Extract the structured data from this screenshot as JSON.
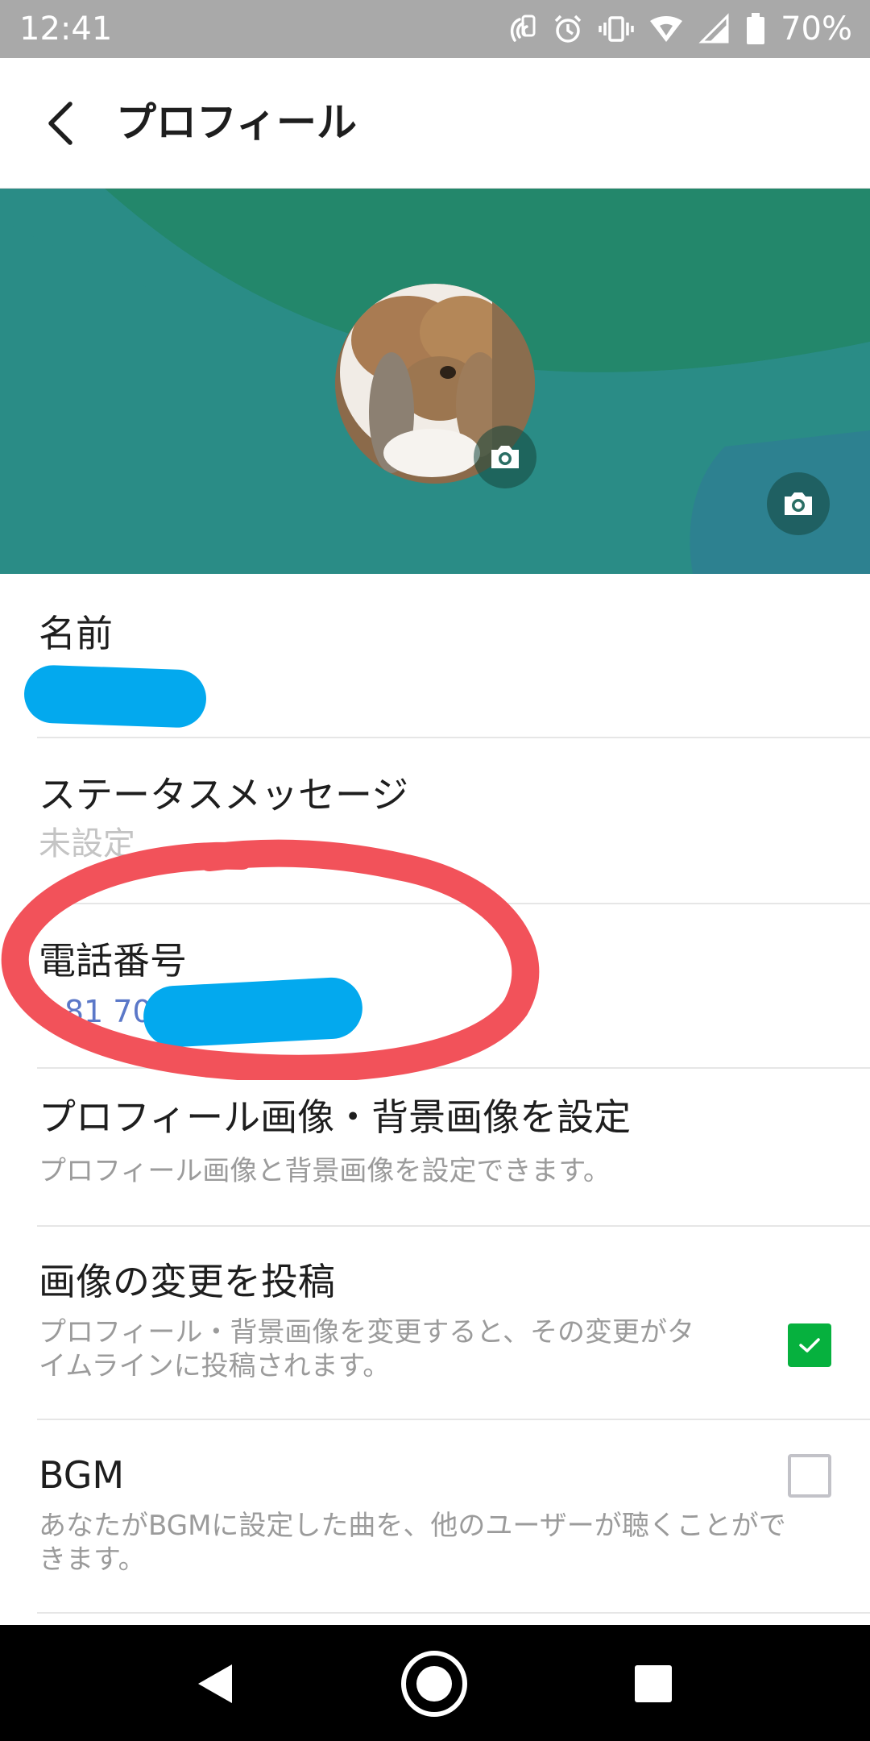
{
  "status_bar": {
    "time": "12:41",
    "battery": "70%",
    "icons": [
      "nfc-icon",
      "alarm-icon",
      "vibrate-icon",
      "wifi-icon",
      "signal-icon",
      "battery-icon"
    ]
  },
  "header": {
    "back_icon": "chevron-left-icon",
    "title": "プロフィール"
  },
  "cover": {
    "avatar_camera_icon": "camera-icon",
    "cover_camera_icon": "camera-icon",
    "colors": {
      "primary": "#23876b",
      "secondary": "#2a8c86",
      "tertiary": "#2d8190"
    }
  },
  "profile": {
    "name": {
      "label": "名前",
      "value": ""
    },
    "status_message": {
      "label": "ステータスメッセージ",
      "value": "未設定"
    },
    "phone": {
      "label": "電話番号",
      "value": "+81 70"
    },
    "set_images": {
      "title": "プロフィール画像・背景画像を設定",
      "description": "プロフィール画像と背景画像を設定できます。"
    },
    "post_image_change": {
      "title": "画像の変更を投稿",
      "description_line1": "プロフィール・背景画像を変更すると、その変更がタ",
      "description_line2": "イムラインに投稿されます。",
      "checked": true
    },
    "bgm": {
      "title": "BGM",
      "description_line1": "あなたがBGMに設定した曲を、他のユーザーが聴くことがで",
      "description_line2": "きます。",
      "checked": false
    }
  },
  "colors": {
    "checkbox_on": "#06b13e",
    "link_blue": "#5b78c8",
    "redaction": "#03a9ee",
    "annotation_red": "#f2525a"
  },
  "nav_bar": {
    "back_icon": "triangle-back-icon",
    "home_icon": "circle-home-icon",
    "recents_icon": "square-recents-icon"
  }
}
